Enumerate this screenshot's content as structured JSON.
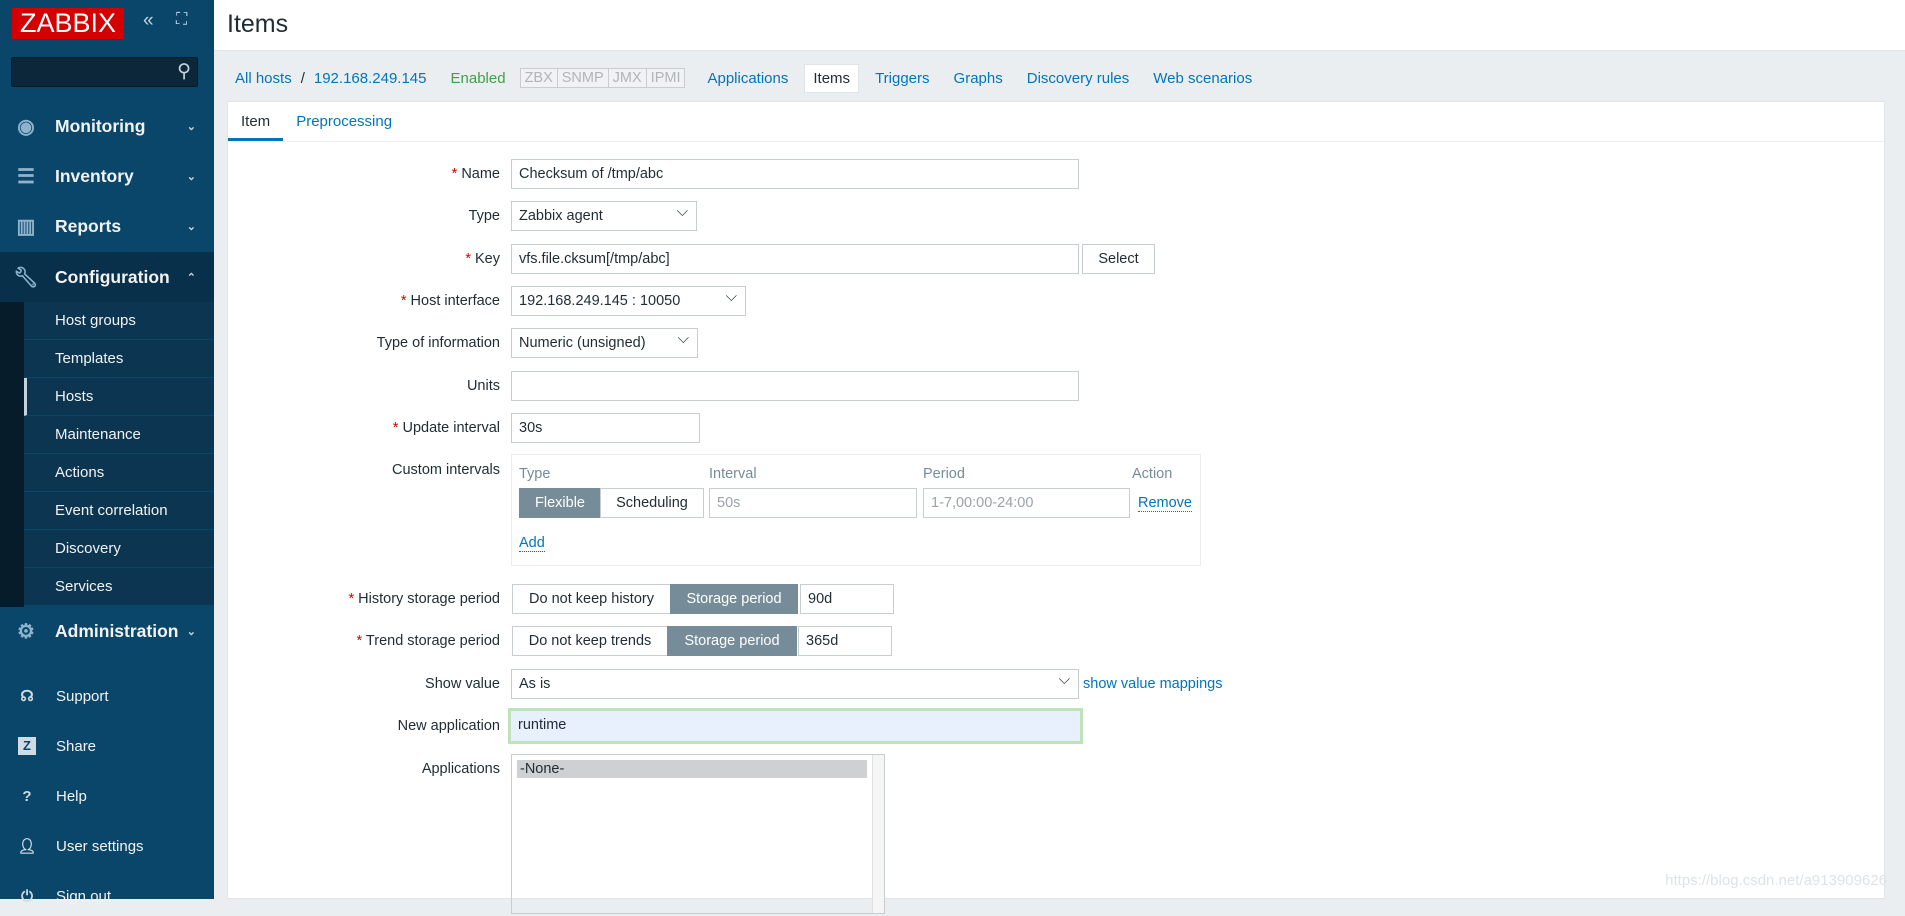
{
  "brand": {
    "logo": "ZABBIX",
    "accent": "#d40000",
    "sidebar_bg": "#0a466a",
    "link_color": "#0275b8"
  },
  "sidebar": {
    "sections": [
      {
        "label": "Monitoring",
        "icon": "eye-icon"
      },
      {
        "label": "Inventory",
        "icon": "list-icon"
      },
      {
        "label": "Reports",
        "icon": "bar-chart-icon"
      },
      {
        "label": "Configuration",
        "icon": "wrench-icon",
        "expanded": true
      },
      {
        "label": "Administration",
        "icon": "gear-icon"
      }
    ],
    "config_items": [
      "Host groups",
      "Templates",
      "Hosts",
      "Maintenance",
      "Actions",
      "Event correlation",
      "Discovery",
      "Services"
    ],
    "active_item": "Hosts",
    "footer": [
      {
        "label": "Support",
        "icon": "headset-icon"
      },
      {
        "label": "Share",
        "icon": "share-z-icon"
      },
      {
        "label": "Help",
        "icon": "help-icon"
      },
      {
        "label": "User settings",
        "icon": "user-icon"
      },
      {
        "label": "Sign out",
        "icon": "power-icon"
      }
    ]
  },
  "header": {
    "title": "Items"
  },
  "nav": {
    "all_hosts": "All hosts",
    "separator": "/",
    "host": "192.168.249.145",
    "status": "Enabled",
    "tags": [
      "ZBX",
      "SNMP",
      "JMX",
      "IPMI"
    ],
    "links": [
      "Applications",
      "Items",
      "Triggers",
      "Graphs",
      "Discovery rules",
      "Web scenarios"
    ],
    "active": "Items"
  },
  "tabs": [
    "Item",
    "Preprocessing"
  ],
  "form": {
    "name": {
      "label": "Name",
      "value": "Checksum of /tmp/abc"
    },
    "type": {
      "label": "Type",
      "value": "Zabbix agent"
    },
    "key": {
      "label": "Key",
      "value": "vfs.file.cksum[/tmp/abc]",
      "button": "Select"
    },
    "host_interface": {
      "label": "Host interface",
      "value": "192.168.249.145 : 10050"
    },
    "type_of_information": {
      "label": "Type of information",
      "value": "Numeric (unsigned)"
    },
    "units": {
      "label": "Units",
      "value": ""
    },
    "update_interval": {
      "label": "Update interval",
      "value": "30s"
    },
    "custom_intervals": {
      "label": "Custom intervals",
      "headers": [
        "Type",
        "Interval",
        "Period",
        "Action"
      ],
      "row": {
        "flexible": "Flexible",
        "scheduling": "Scheduling",
        "interval_placeholder": "50s",
        "period_placeholder": "1-7,00:00-24:00",
        "remove": "Remove"
      },
      "add": "Add"
    },
    "history": {
      "label": "History storage period",
      "opt1": "Do not keep history",
      "opt2": "Storage period",
      "value": "90d"
    },
    "trend": {
      "label": "Trend storage period",
      "opt1": "Do not keep trends",
      "opt2": "Storage period",
      "value": "365d"
    },
    "show_value": {
      "label": "Show value",
      "value": "As is",
      "link": "show value mappings"
    },
    "new_application": {
      "label": "New application",
      "value": "runtime"
    },
    "applications": {
      "label": "Applications",
      "options": [
        "-None-"
      ]
    }
  },
  "watermark": "https://blog.csdn.net/a913909626"
}
